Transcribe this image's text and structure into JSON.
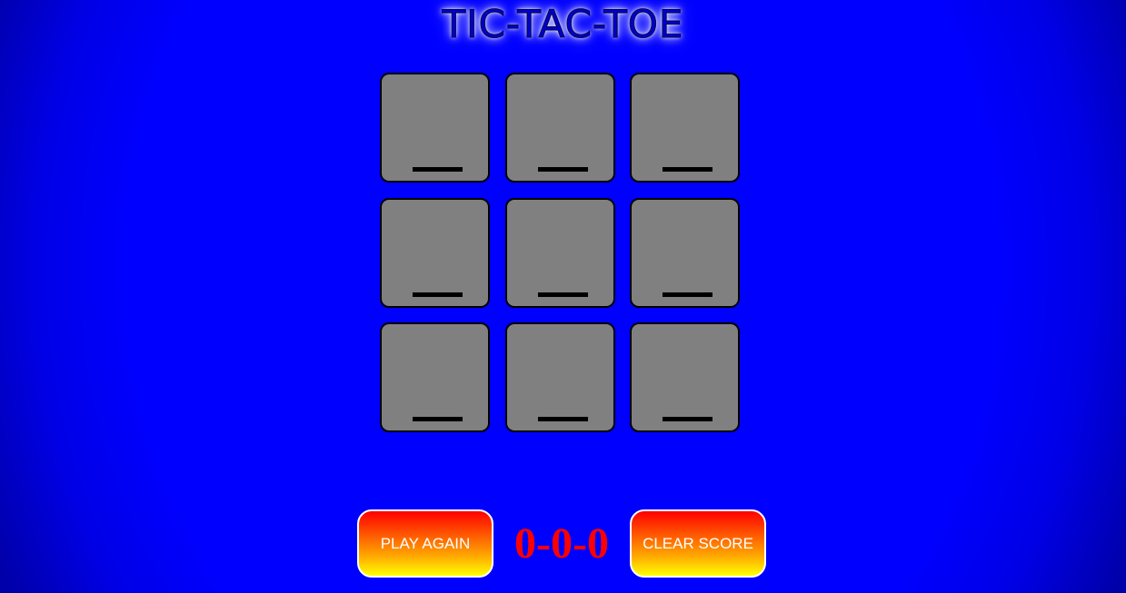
{
  "title": "TIC-TAC-TOE",
  "board": {
    "cells": [
      {
        "mark": "_"
      },
      {
        "mark": "_"
      },
      {
        "mark": "_"
      },
      {
        "mark": "_"
      },
      {
        "mark": "_"
      },
      {
        "mark": "_"
      },
      {
        "mark": "_"
      },
      {
        "mark": "_"
      },
      {
        "mark": "_"
      }
    ]
  },
  "controls": {
    "play_again_label": "PLAY AGAIN",
    "clear_score_label": "CLEAR SCORE"
  },
  "score": "0-0-0",
  "colors": {
    "background": "#0000ff",
    "cell": "#808080",
    "score_text": "#ff0000",
    "button_gradient_top": "#ff0000",
    "button_gradient_bottom": "#ffff00"
  }
}
